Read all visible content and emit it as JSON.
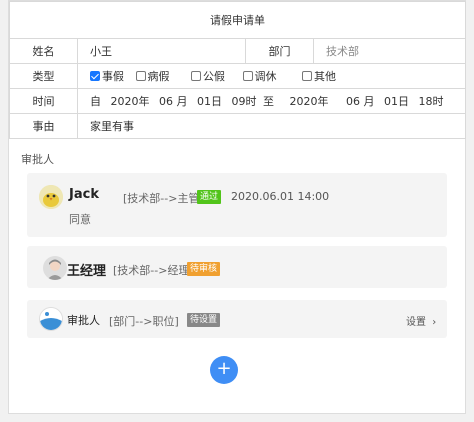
{
  "form": {
    "title": "请假申请单",
    "name_label": "姓名",
    "name_value": "小王",
    "dept_label": "部门",
    "dept_value": "技术部",
    "type_label": "类型",
    "types": [
      {
        "label": "事假",
        "checked": true
      },
      {
        "label": "病假",
        "checked": false
      },
      {
        "label": "公假",
        "checked": false
      },
      {
        "label": "调休",
        "checked": false
      },
      {
        "label": "其他",
        "checked": false
      }
    ],
    "time_label": "时间",
    "time": {
      "from_word": "自",
      "from_year": "2020年",
      "from_month": "06 月",
      "from_day": "01日",
      "from_hour": "09时",
      "to_word": "至",
      "to_year": "2020年",
      "to_month": "06 月",
      "to_day": "01日",
      "to_hour": "18时"
    },
    "reason_label": "事由",
    "reason_value": "家里有事"
  },
  "approval": {
    "title": "审批人",
    "approvers": [
      {
        "name": "Jack",
        "role": "[技术部-->主管]",
        "badge": "通过",
        "badge_color": "#52c41a",
        "timestamp": "2020.06.01 14:00",
        "comment": "同意"
      },
      {
        "name": "王经理",
        "role": "[技术部-->经理]",
        "badge": "待审核",
        "badge_color": "#f0a030"
      },
      {
        "name": "审批人",
        "role": "[部门-->职位]",
        "badge": "待设置",
        "badge_color": "#888888",
        "action": "设置"
      }
    ],
    "add_symbol": "+"
  }
}
